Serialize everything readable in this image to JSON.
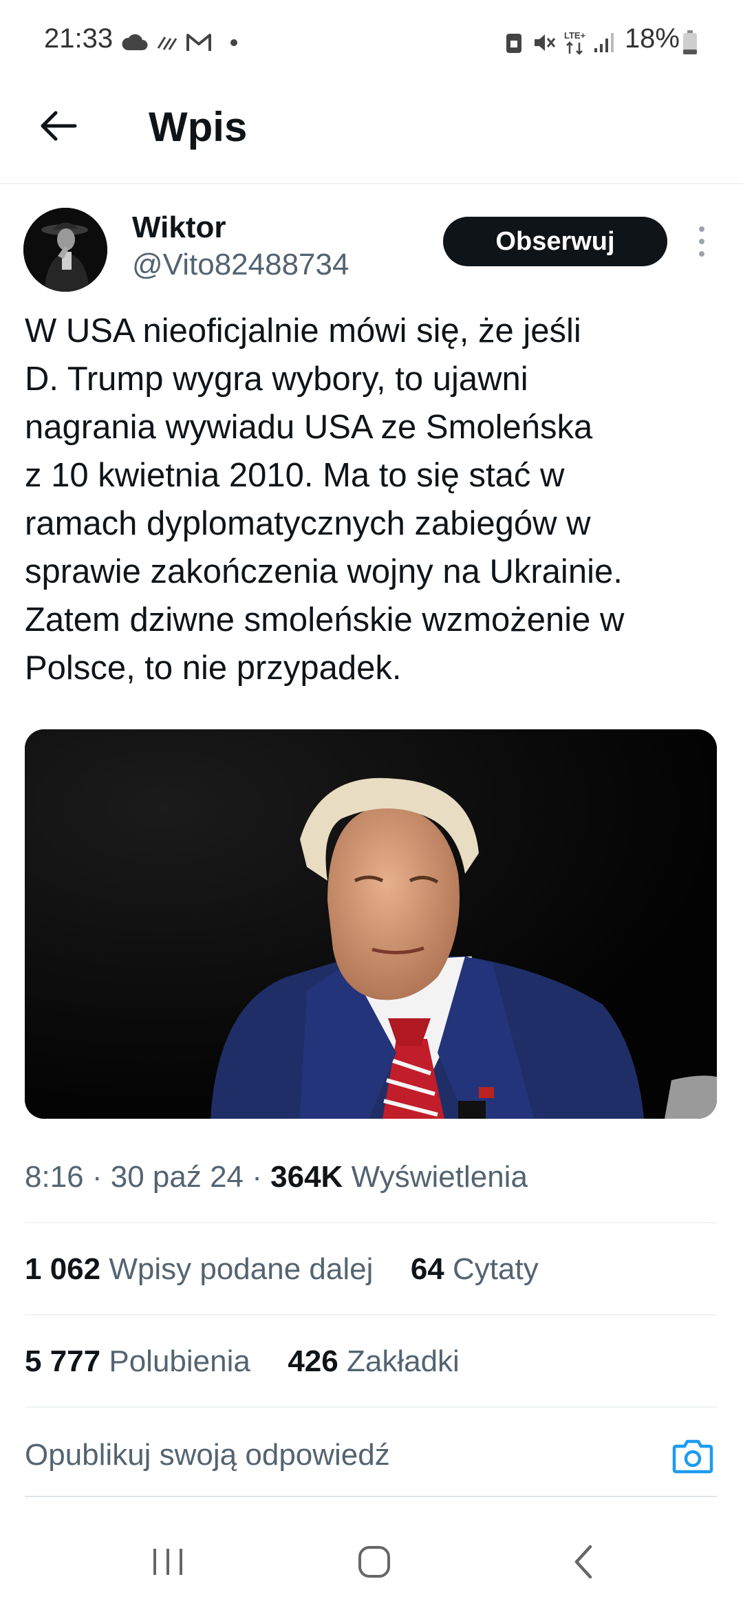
{
  "status_bar": {
    "time": "21:33",
    "battery": "18%",
    "network": "LTE+",
    "left_icons": [
      "cloud-icon",
      "sync-icon",
      "gmail-icon",
      "dot-icon"
    ],
    "right_icons": [
      "lock-icon",
      "mute-icon",
      "lte-icon",
      "signal-icon",
      "battery-icon"
    ]
  },
  "header": {
    "title": "Wpis"
  },
  "author": {
    "name": "Wiktor",
    "handle": "@Vito82488734",
    "follow_label": "Obserwuj"
  },
  "tweet": {
    "lines": [
      "W USA nieoficjalnie mówi się, że jeśli",
      "D. Trump wygra wybory, to ujawni",
      "nagrania wywiadu USA ze Smoleńska",
      "z 10 kwietnia 2010. Ma to się stać w",
      "ramach dyplomatycznych zabiegów w",
      "sprawie zakończenia wojny na Ukrainie.",
      "Zatem dziwne smoleńskie wzmożenie w",
      "Polsce, to nie przypadek."
    ]
  },
  "meta": {
    "time": "8:16",
    "sep": " · ",
    "date": "30 paź 24",
    "views_count": "364K",
    "views_label": "Wyświetlenia"
  },
  "stats": {
    "reposts_count": "1 062",
    "reposts_label": "Wpisy podane dalej",
    "quotes_count": "64",
    "quotes_label": "Cytaty",
    "likes_count": "5 777",
    "likes_label": "Polubienia",
    "bookmarks_count": "426",
    "bookmarks_label": "Zakładki"
  },
  "reply": {
    "placeholder": "Opublikuj swoją odpowiedź"
  },
  "colors": {
    "accent": "#1d9bf0",
    "text": "#0f1419",
    "secondary": "#536471",
    "divider": "#eff3f4"
  }
}
